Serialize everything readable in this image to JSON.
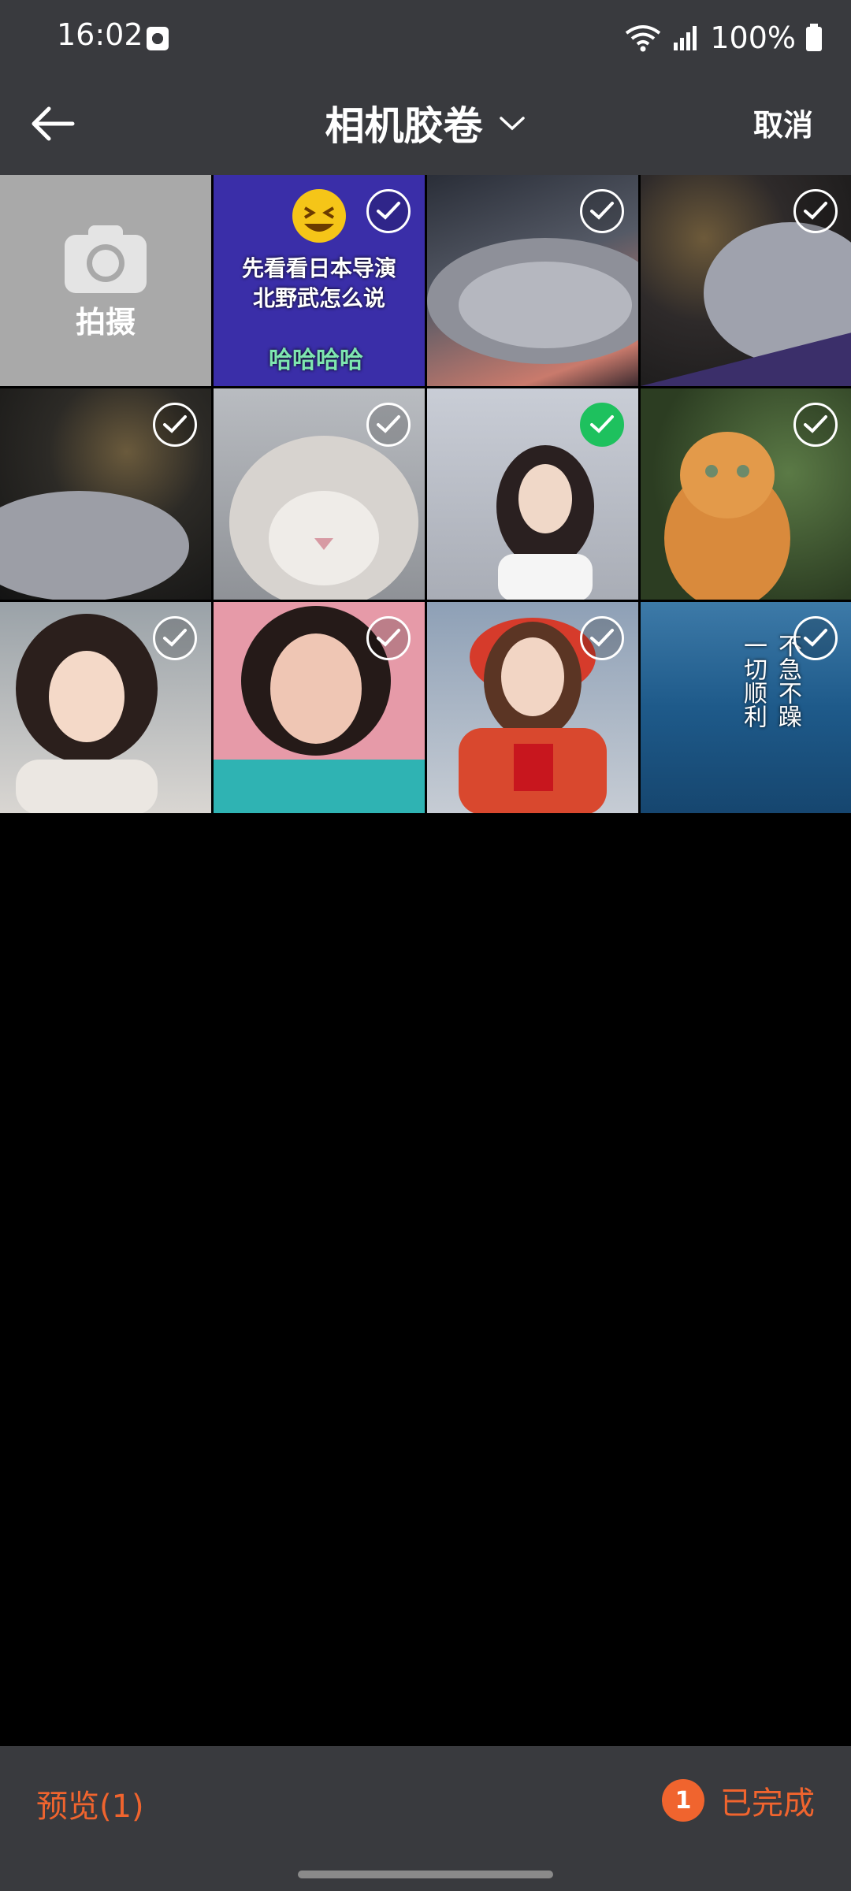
{
  "status": {
    "time": "16:02",
    "battery": "100%"
  },
  "header": {
    "title": "相机胶卷",
    "cancel": "取消"
  },
  "camera_tile": {
    "label": "拍摄"
  },
  "photos": [
    {
      "id": 1,
      "selected": false,
      "overlay_text": "先看看日本导演\n北野武怎么说",
      "overlay_text2": "哈哈哈哈"
    },
    {
      "id": 2,
      "selected": false
    },
    {
      "id": 3,
      "selected": false
    },
    {
      "id": 4,
      "selected": false
    },
    {
      "id": 5,
      "selected": false
    },
    {
      "id": 6,
      "selected": true
    },
    {
      "id": 7,
      "selected": false
    },
    {
      "id": 8,
      "selected": false
    },
    {
      "id": 9,
      "selected": false
    },
    {
      "id": 10,
      "selected": false
    },
    {
      "id": 11,
      "selected": false,
      "overlay_text": "不急不躁\n一切顺利"
    }
  ],
  "footer": {
    "preview": "预览(1)",
    "badge": "1",
    "done": "已完成"
  },
  "colors": {
    "accent": "#f0642e",
    "selected": "#1ec15e",
    "bar": "#393a3e"
  }
}
